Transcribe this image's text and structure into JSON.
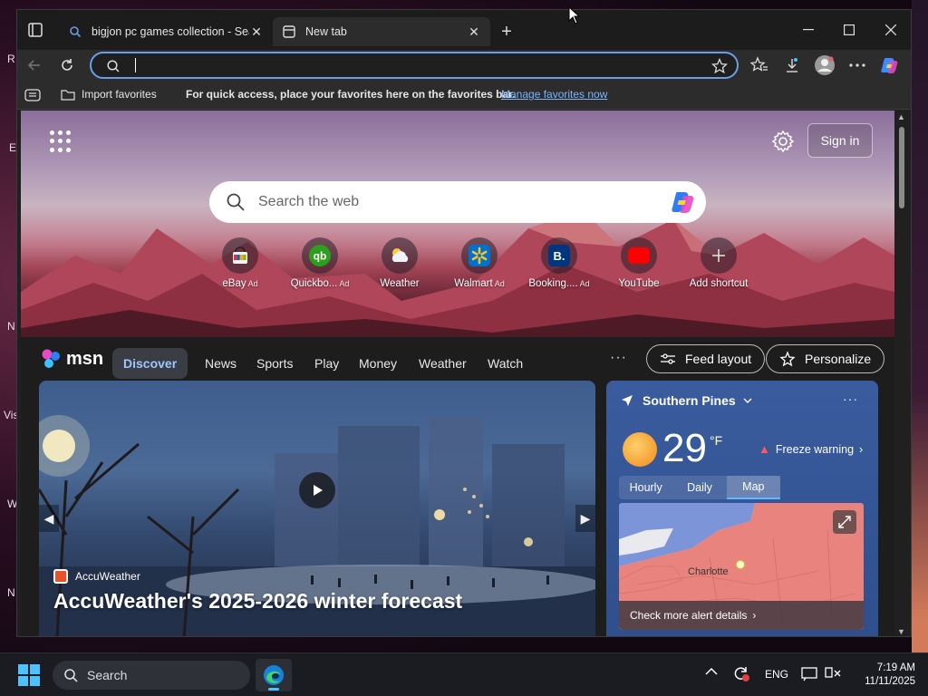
{
  "desktop": {
    "left_letters": [
      "R",
      "E",
      "N",
      "Vis",
      "W",
      "N"
    ]
  },
  "browser": {
    "tabs": [
      {
        "title": "bigjon pc games collection - Sear",
        "active": false
      },
      {
        "title": "New tab",
        "active": true
      }
    ],
    "address": {
      "value": ""
    },
    "favorites_bar": {
      "import_label": "Import favorites",
      "message": "For quick access, place your favorites here on the favorites bar.",
      "link": "Manage favorites now"
    }
  },
  "ntp": {
    "sign_in": "Sign in",
    "search": {
      "placeholder": "Search the web"
    },
    "shortcuts": [
      {
        "label": "eBay",
        "ad": "Ad"
      },
      {
        "label": "Quickbo...",
        "ad": "Ad"
      },
      {
        "label": "Weather",
        "ad": ""
      },
      {
        "label": "Walmart",
        "ad": "Ad"
      },
      {
        "label": "Booking....",
        "ad": "Ad"
      },
      {
        "label": "YouTube",
        "ad": ""
      },
      {
        "label": "Add shortcut",
        "ad": ""
      }
    ],
    "feed": {
      "brand": "msn",
      "nav": [
        "Discover",
        "News",
        "Sports",
        "Play",
        "Money",
        "Weather",
        "Watch"
      ],
      "more": "···",
      "feed_layout": "Feed layout",
      "personalize": "Personalize"
    },
    "story": {
      "source": "AccuWeather",
      "headline": "AccuWeather's 2025-2026 winter forecast"
    },
    "weather": {
      "location": "Southern Pines",
      "temperature": "29",
      "unit": "°F",
      "alert": "Freeze warning",
      "tabs": [
        "Hourly",
        "Daily",
        "Map"
      ],
      "active_tab": "Map",
      "map_city": "Charlotte",
      "footer": "Check more alert details"
    }
  },
  "taskbar": {
    "search_label": "Search",
    "language": "ENG",
    "time": "7:19 AM",
    "date": "11/11/2025"
  },
  "colors": {
    "accent": "#4cc2ff",
    "link": "#7cb4ff",
    "alert": "#ff5a5a"
  }
}
